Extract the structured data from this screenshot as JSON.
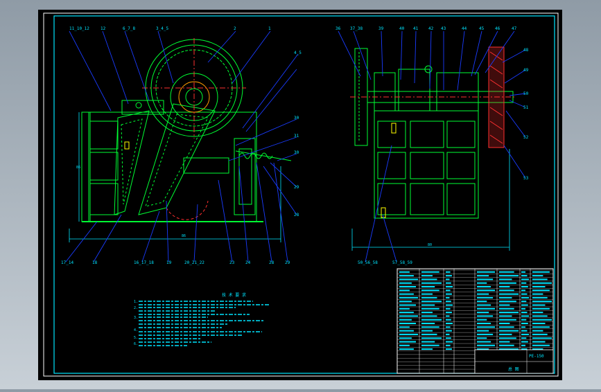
{
  "colors": {
    "background": "#000000",
    "frame": "#ffffff",
    "border": "#00e5ff",
    "part": "#00ff33",
    "leader": "#1a3cff",
    "section": "#ff3030",
    "text": "#00e5ff",
    "yellow": "#ffff00",
    "window_bg": "#aab4bd"
  },
  "left_view": {
    "top_callouts": [
      "11_10_12",
      "12",
      "6_7_8",
      "3_4_5",
      "2",
      "1"
    ],
    "right_callouts": [
      "4_5",
      "30",
      "31",
      "30",
      "29",
      "28"
    ],
    "bottom_callouts": [
      "17_14",
      "18",
      "16_17_18",
      "19",
      "20_21_22",
      "23",
      "24",
      "28",
      "29"
    ],
    "dim_height": "86",
    "dim_width": "86"
  },
  "right_view": {
    "top_callouts": [
      "36",
      "37_38",
      "39",
      "40",
      "41",
      "42",
      "43",
      "44",
      "45",
      "46",
      "47"
    ],
    "right_callouts": [
      "48",
      "49",
      "50",
      "51",
      "52",
      "53"
    ],
    "bottom_callouts": [
      "50_56_58",
      "57_58_59"
    ],
    "dim_width": "80"
  },
  "notes": {
    "title": "技 术 要 求",
    "items": [
      "1.",
      "2.",
      "3.",
      "4.",
      "5.",
      "6."
    ]
  },
  "title_block": {
    "drawing_no": "PE-150",
    "label": "总 图"
  }
}
